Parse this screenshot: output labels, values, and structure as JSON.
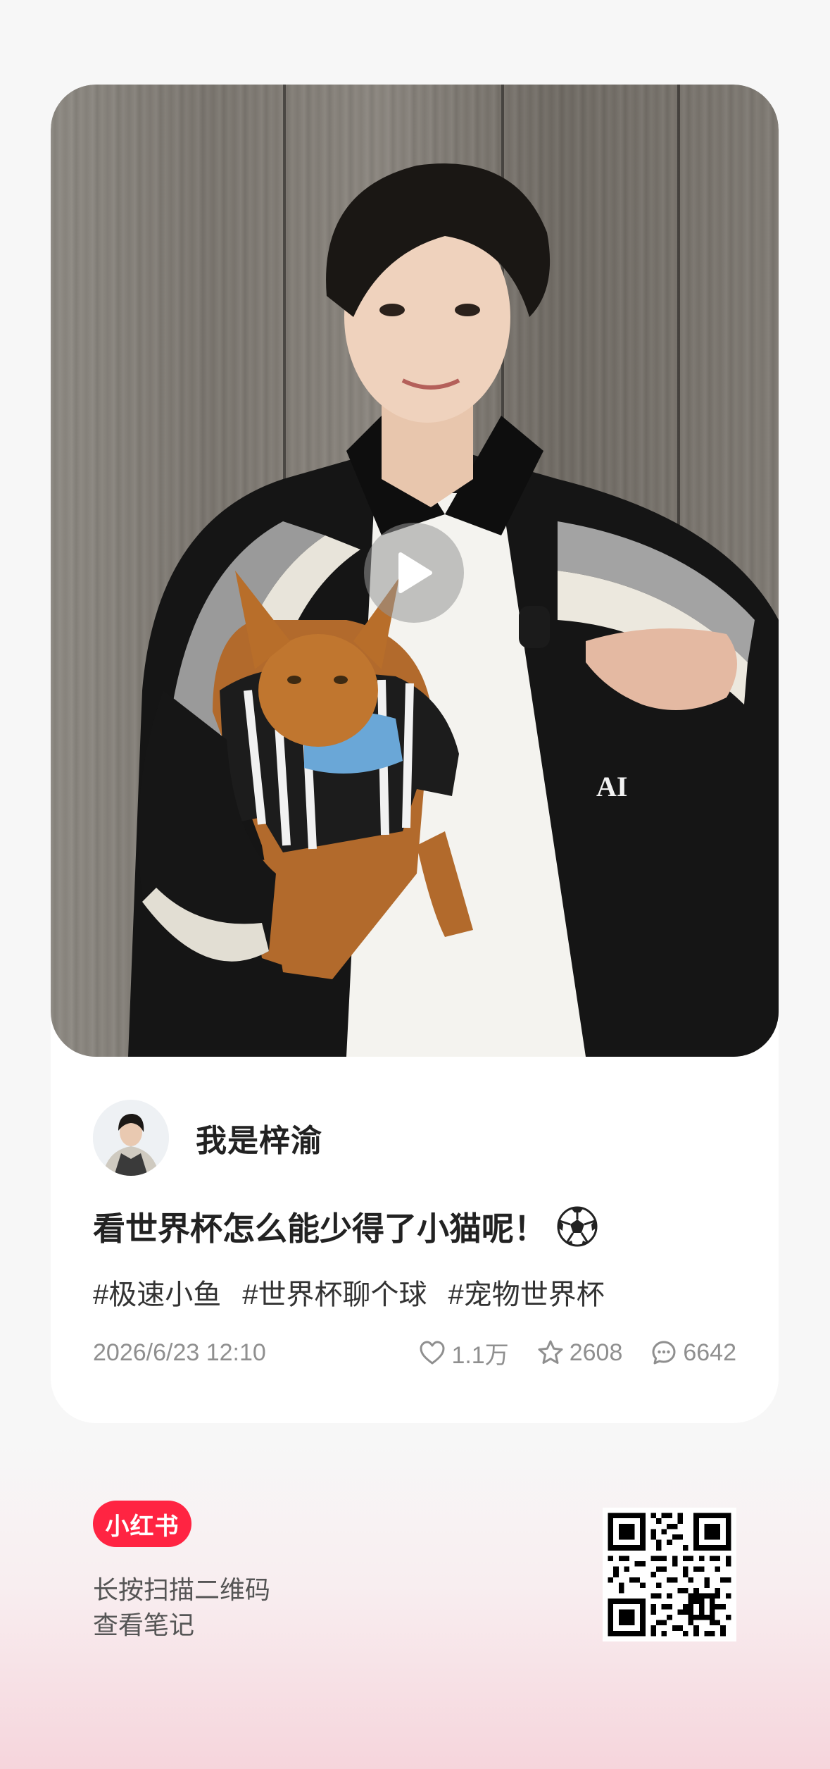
{
  "author": {
    "name": "我是梓渝"
  },
  "note": {
    "title": "看世界杯怎么能少得了小猫呢！",
    "title_emoji": "⚽",
    "tags": [
      "#极速小鱼",
      "#世界杯聊个球",
      "#宠物世界杯"
    ],
    "date": "2026/6/23 12:10",
    "likes": "1.1万",
    "collects": "2608",
    "comments": "6642"
  },
  "footer": {
    "logo_text": "小红书",
    "line1": "长按扫描二维码",
    "line2": "查看笔记"
  },
  "icons": {
    "play": "play-icon",
    "like": "heart-icon",
    "collect": "star-icon",
    "comment": "comment-icon",
    "qr": "qr-code"
  },
  "colors": {
    "brand": "#ff2442",
    "text_primary": "#222222",
    "text_muted": "#8f8f8f"
  }
}
